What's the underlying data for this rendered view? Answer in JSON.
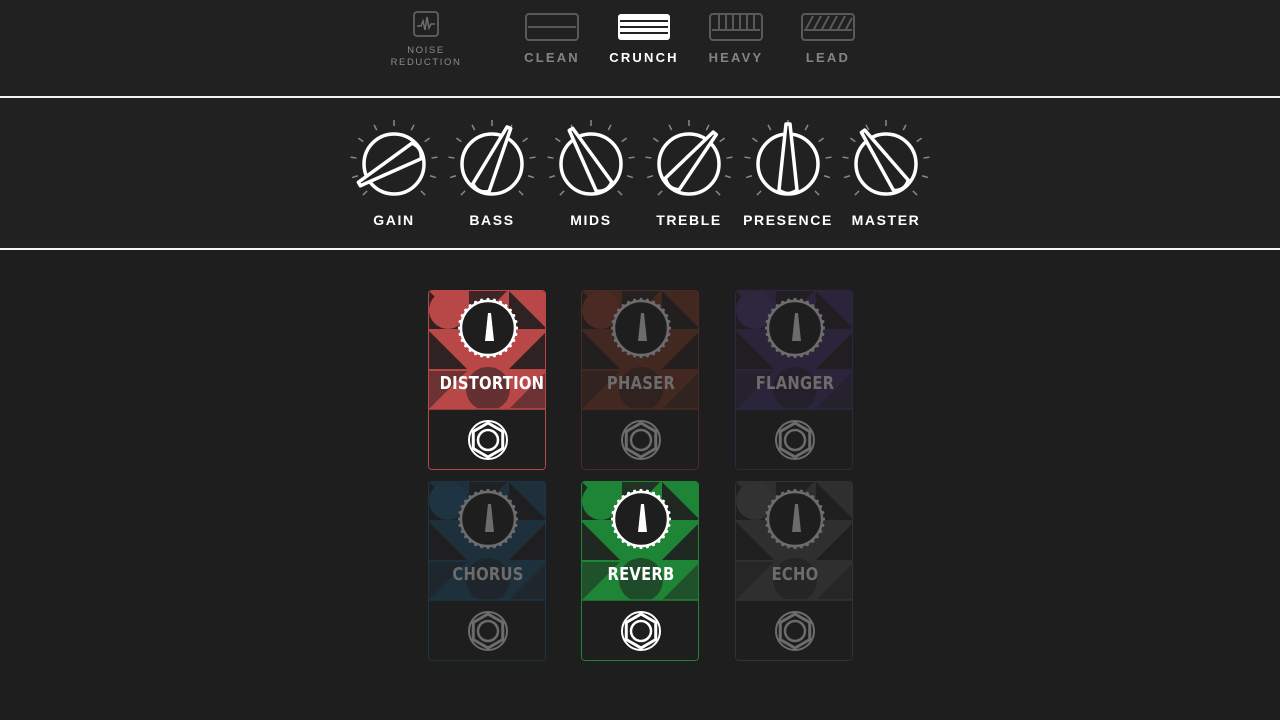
{
  "noise_reduction": {
    "label_line1": "NOISE",
    "label_line2": "REDUCTION",
    "icon": "waveform-icon"
  },
  "amp_modes": [
    {
      "label": "CLEAN",
      "active": false,
      "icon": "clean-mode-icon"
    },
    {
      "label": "CRUNCH",
      "active": true,
      "icon": "crunch-mode-icon"
    },
    {
      "label": "HEAVY",
      "active": false,
      "icon": "heavy-mode-icon"
    },
    {
      "label": "LEAD",
      "active": false,
      "icon": "lead-mode-icon"
    }
  ],
  "knobs": [
    {
      "label": "GAIN",
      "angle_deg": -120
    },
    {
      "label": "BASS",
      "angle_deg": 25
    },
    {
      "label": "MIDS",
      "angle_deg": -30
    },
    {
      "label": "TREBLE",
      "angle_deg": 40
    },
    {
      "label": "PRESENCE",
      "angle_deg": 0
    },
    {
      "label": "MASTER",
      "angle_deg": -35
    }
  ],
  "pedals": [
    {
      "name": "DISTORTION",
      "active": true,
      "color": "#b84747"
    },
    {
      "name": "PHASER",
      "active": false,
      "color": "#4a2a22"
    },
    {
      "name": "FLANGER",
      "active": false,
      "color": "#2d2740"
    },
    {
      "name": "CHORUS",
      "active": false,
      "color": "#1e3442"
    },
    {
      "name": "REVERB",
      "active": true,
      "color": "#1e8436"
    },
    {
      "name": "ECHO",
      "active": false,
      "color": "#333233"
    }
  ],
  "colors": {
    "background": "#1f1e1f",
    "panel": "#222122",
    "text_active": "#ffffff",
    "text_inactive": "#858485"
  }
}
